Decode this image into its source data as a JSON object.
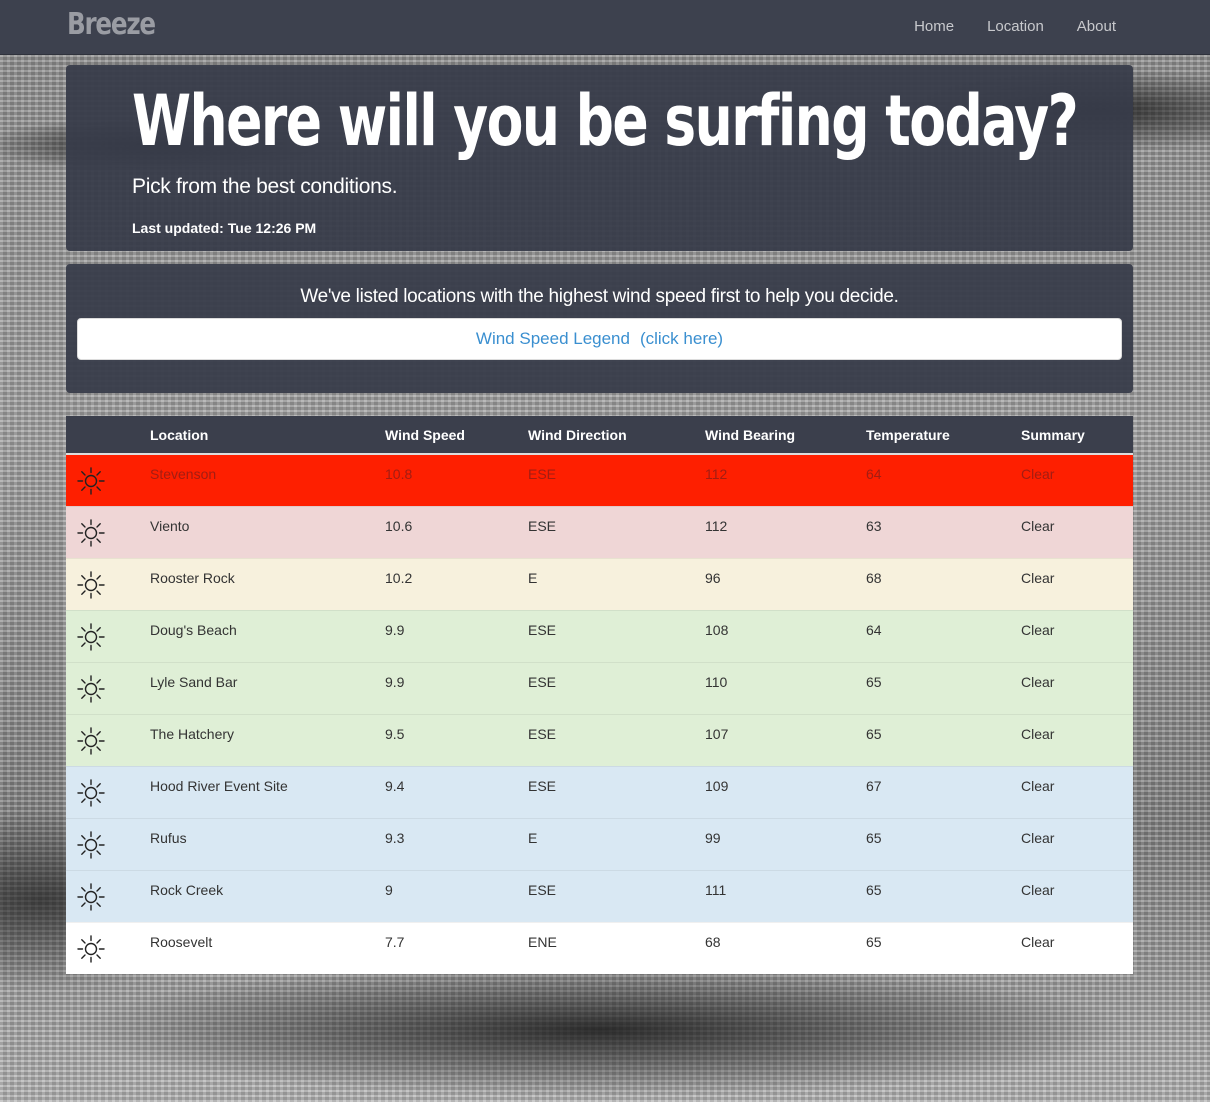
{
  "nav": {
    "brand": "Breeze",
    "links": [
      "Home",
      "Location",
      "About"
    ]
  },
  "hero": {
    "title": "Where will you be surfing today?",
    "subtitle": "Pick from the best conditions.",
    "updated_label": "Last updated:",
    "updated_value": "Tue 12:26 PM"
  },
  "info": {
    "text": "We've listed locations with the highest wind speed first to help you decide.",
    "legend_label": "Wind Speed Legend",
    "legend_hint": "(click here)"
  },
  "table": {
    "columns": [
      "",
      "Location",
      "Wind Speed",
      "Wind Direction",
      "Wind Bearing",
      "Temperature",
      "Summary"
    ],
    "rows": [
      {
        "icon": "sun-icon",
        "location": "Stevenson",
        "wind_speed": "10.8",
        "wind_direction": "ESE",
        "wind_bearing": "112",
        "temperature": "64",
        "summary": "Clear",
        "color": "#fe1f00"
      },
      {
        "icon": "sun-icon",
        "location": "Viento",
        "wind_speed": "10.6",
        "wind_direction": "ESE",
        "wind_bearing": "112",
        "temperature": "63",
        "summary": "Clear",
        "color": "#efd6d6"
      },
      {
        "icon": "sun-icon",
        "location": "Rooster Rock",
        "wind_speed": "10.2",
        "wind_direction": "E",
        "wind_bearing": "96",
        "temperature": "68",
        "summary": "Clear",
        "color": "#f7f1dd"
      },
      {
        "icon": "sun-icon",
        "location": "Doug's Beach",
        "wind_speed": "9.9",
        "wind_direction": "ESE",
        "wind_bearing": "108",
        "temperature": "64",
        "summary": "Clear",
        "color": "#dfefd6"
      },
      {
        "icon": "sun-icon",
        "location": "Lyle Sand Bar",
        "wind_speed": "9.9",
        "wind_direction": "ESE",
        "wind_bearing": "110",
        "temperature": "65",
        "summary": "Clear",
        "color": "#dfefd6"
      },
      {
        "icon": "sun-icon",
        "location": "The Hatchery",
        "wind_speed": "9.5",
        "wind_direction": "ESE",
        "wind_bearing": "107",
        "temperature": "65",
        "summary": "Clear",
        "color": "#dfefd6"
      },
      {
        "icon": "sun-icon",
        "location": "Hood River Event Site",
        "wind_speed": "9.4",
        "wind_direction": "ESE",
        "wind_bearing": "109",
        "temperature": "67",
        "summary": "Clear",
        "color": "#d9e8f3"
      },
      {
        "icon": "sun-icon",
        "location": "Rufus",
        "wind_speed": "9.3",
        "wind_direction": "E",
        "wind_bearing": "99",
        "temperature": "65",
        "summary": "Clear",
        "color": "#d9e8f3"
      },
      {
        "icon": "sun-icon",
        "location": "Rock Creek",
        "wind_speed": "9",
        "wind_direction": "ESE",
        "wind_bearing": "111",
        "temperature": "65",
        "summary": "Clear",
        "color": "#d9e8f3"
      },
      {
        "icon": "sun-icon",
        "location": "Roosevelt",
        "wind_speed": "7.7",
        "wind_direction": "ENE",
        "wind_bearing": "68",
        "temperature": "65",
        "summary": "Clear",
        "color": "#ffffff"
      }
    ]
  }
}
